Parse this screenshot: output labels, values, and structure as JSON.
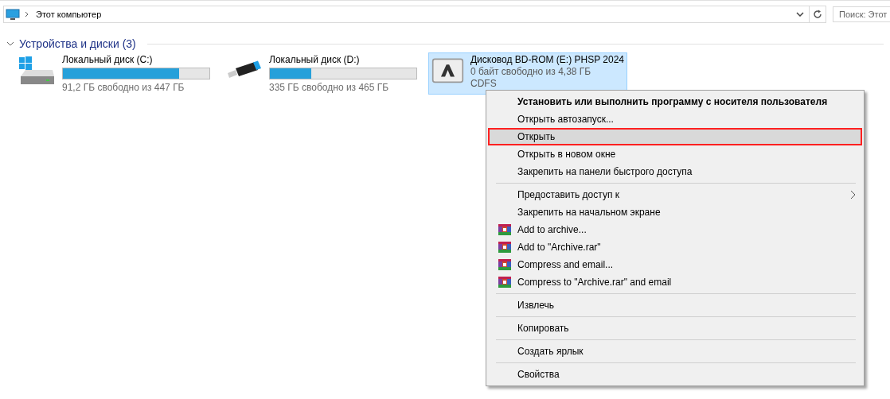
{
  "address_bar": {
    "path": "Этот компьютер"
  },
  "search": {
    "placeholder": "Поиск: Этот"
  },
  "group": {
    "title": "Устройства и диски (3)",
    "expanded": true
  },
  "drives": [
    {
      "kind": "hdd",
      "name": "Локальный диск (C:)",
      "level": 0.796,
      "info": "91,2 ГБ свободно из 447 ГБ",
      "selected": false
    },
    {
      "kind": "usb",
      "name": "Локальный диск (D:)",
      "level": 0.28,
      "info": "335 ГБ свободно из 465 ГБ",
      "selected": false
    },
    {
      "kind": "optical",
      "name": "Дисковод BD-ROM (E:) PHSP 2024",
      "info": "0 байт свободно из 4,38 ГБ",
      "filesystem": "CDFS",
      "selected": true
    }
  ],
  "context_menu": [
    {
      "kind": "item",
      "label": "Установить или выполнить программу с носителя пользователя",
      "bold": true,
      "selected": false
    },
    {
      "kind": "item",
      "label": "Открыть автозапуск...",
      "selected": false
    },
    {
      "kind": "item",
      "label": "Открыть",
      "selected": true
    },
    {
      "kind": "item",
      "label": "Открыть в новом окне",
      "selected": false
    },
    {
      "kind": "item",
      "label": "Закрепить на панели быстрого доступа",
      "selected": false
    },
    {
      "kind": "separator"
    },
    {
      "kind": "item",
      "label": "Предоставить доступ к",
      "submenu": true,
      "selected": false
    },
    {
      "kind": "item",
      "label": "Закрепить на начальном экране",
      "selected": false
    },
    {
      "kind": "rar",
      "label": "Add to archive...",
      "selected": false
    },
    {
      "kind": "rar",
      "label": "Add to \"Archive.rar\"",
      "selected": false
    },
    {
      "kind": "rar",
      "label": "Compress and email...",
      "selected": false
    },
    {
      "kind": "rar",
      "label": "Compress to \"Archive.rar\" and email",
      "selected": false
    },
    {
      "kind": "separator"
    },
    {
      "kind": "item",
      "label": "Извлечь",
      "selected": false
    },
    {
      "kind": "separator"
    },
    {
      "kind": "item",
      "label": "Копировать",
      "selected": false
    },
    {
      "kind": "separator"
    },
    {
      "kind": "item",
      "label": "Создать ярлык",
      "selected": false
    },
    {
      "kind": "separator"
    },
    {
      "kind": "item",
      "label": "Свойства",
      "selected": false
    }
  ]
}
